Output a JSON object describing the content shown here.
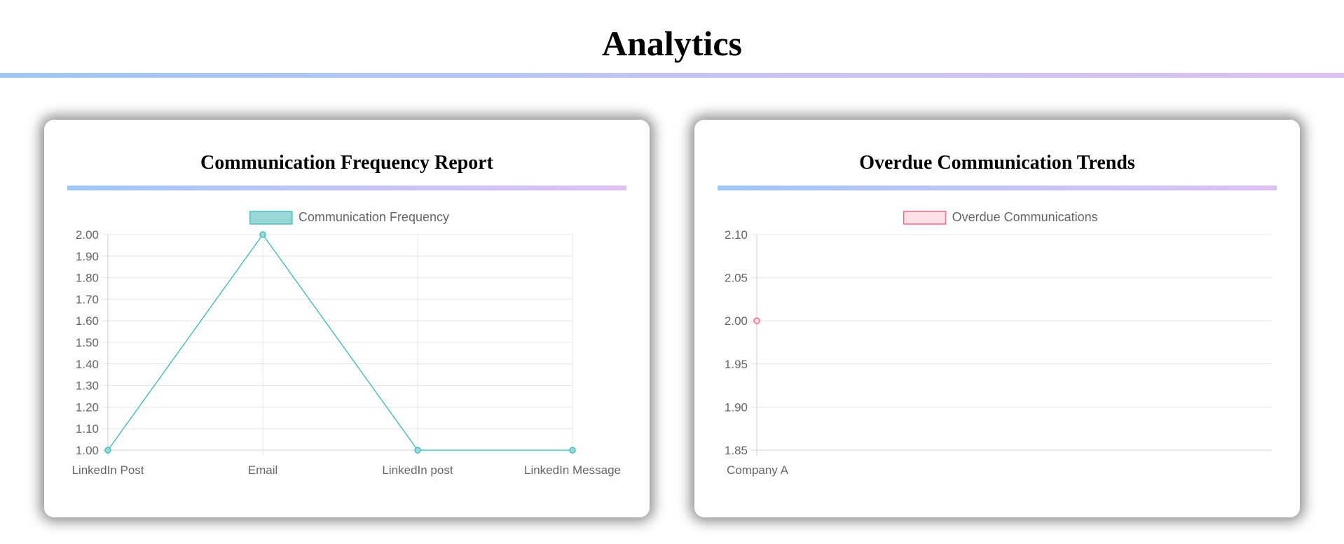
{
  "page": {
    "title": "Analytics"
  },
  "chart_data": [
    {
      "type": "line",
      "title": "Communication Frequency Report",
      "categories": [
        "LinkedIn Post",
        "Email",
        "LinkedIn post",
        "LinkedIn Message"
      ],
      "series": [
        {
          "name": "Communication Frequency",
          "values": [
            1,
            2,
            1,
            1
          ],
          "color": "#4bc0c0",
          "fill": "#9ad8d8"
        }
      ],
      "ylim": [
        1.0,
        2.0
      ],
      "yticks": [
        "2.00",
        "1.90",
        "1.80",
        "1.70",
        "1.60",
        "1.50",
        "1.40",
        "1.30",
        "1.20",
        "1.10",
        "1.00"
      ],
      "grid": true,
      "legend": "top-center"
    },
    {
      "type": "line",
      "title": "Overdue Communication Trends",
      "categories": [
        "Company A"
      ],
      "series": [
        {
          "name": "Overdue Communications",
          "values": [
            2
          ],
          "color": "#ff6384",
          "fill": "#ffe0e6"
        }
      ],
      "ylim": [
        1.85,
        2.1
      ],
      "yticks": [
        "2.10",
        "2.05",
        "2.00",
        "1.95",
        "1.90",
        "1.85"
      ],
      "grid": true,
      "legend": "top-center"
    }
  ]
}
